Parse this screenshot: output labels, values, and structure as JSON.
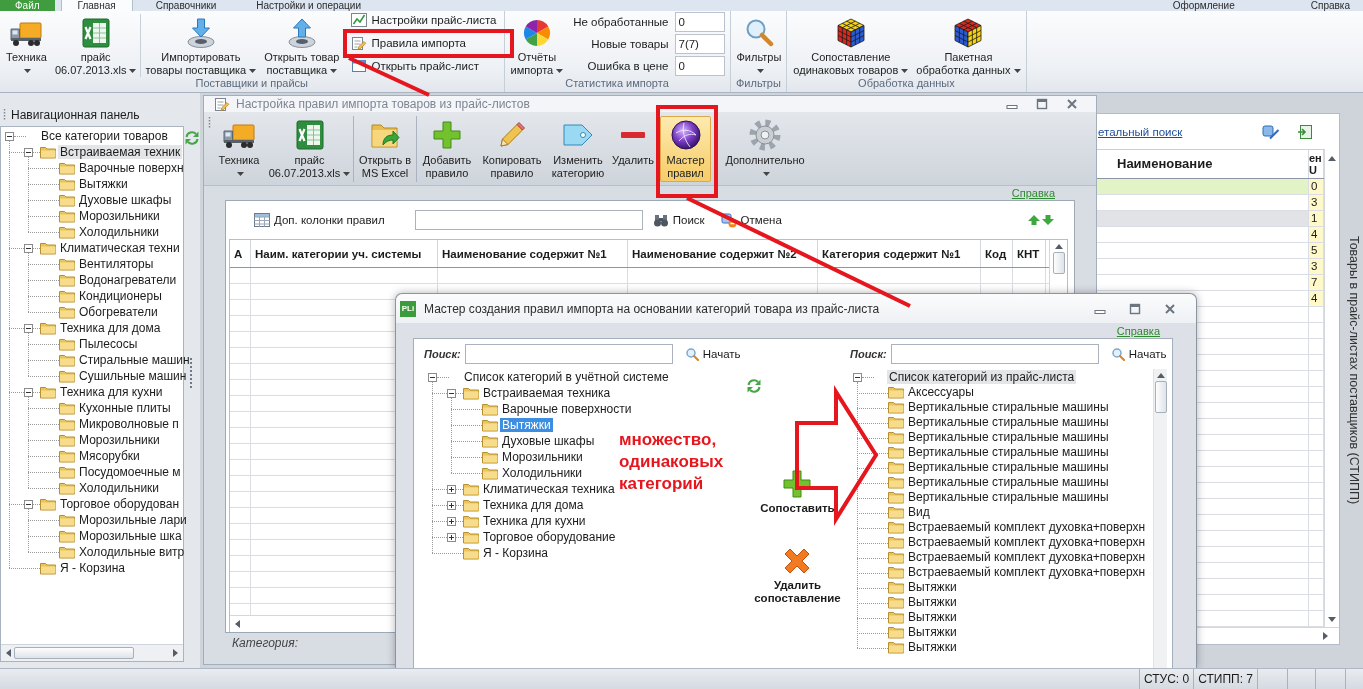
{
  "tabs": [
    {
      "label": "Файл",
      "kind": "file",
      "selected": false
    },
    {
      "label": "Главная",
      "kind": "tab",
      "selected": true
    },
    {
      "label": "Справочники",
      "kind": "tab",
      "selected": false
    },
    {
      "label": "Настройки и операции",
      "kind": "tab",
      "selected": false
    }
  ],
  "tabs_right": [
    "Оформление",
    "Справка"
  ],
  "ribbon": {
    "groups": [
      {
        "label": "Поставщики и прайсы",
        "sections": [
          [
            {
              "kind": "large",
              "label": [
                "Техника"
              ],
              "dropdown": true
            },
            {
              "kind": "large",
              "label": [
                "прайс",
                "06.07.2013.xls"
              ],
              "dropdown": true
            }
          ],
          [
            {
              "kind": "large",
              "label": [
                "Импортировать",
                "товары поставщика"
              ],
              "dropdown": true
            },
            {
              "kind": "large",
              "label": [
                "Открыть товар",
                "поставщика"
              ],
              "dropdown": true
            },
            {
              "kind": "small_stack",
              "items": [
                "Настройки прайс-листа",
                "Правила импорта",
                "Открыть прайс-лист"
              ]
            }
          ]
        ]
      },
      {
        "label": "Статистика импорта",
        "sections": [
          [
            {
              "kind": "large",
              "label": [
                "Отчёты",
                "импорта"
              ],
              "dropdown": true
            },
            {
              "kind": "stats",
              "rows": [
                {
                  "label": "Не обработанные",
                  "value": "0"
                },
                {
                  "label": "Новые товары",
                  "value": "7(7)"
                },
                {
                  "label": "Ошибка в цене",
                  "value": "0"
                }
              ]
            }
          ]
        ]
      },
      {
        "label": "Фильтры",
        "sections": [
          [
            {
              "kind": "large",
              "label": [
                "Фильтры"
              ],
              "dropdown": true
            }
          ]
        ]
      },
      {
        "label": "Обработка данных",
        "sections": [
          [
            {
              "kind": "large",
              "label": [
                "Сопоставление",
                "одинаковых товаров"
              ],
              "dropdown": true
            },
            {
              "kind": "large",
              "label": [
                "Пакетная",
                "обработка данных"
              ],
              "dropdown": true
            }
          ]
        ]
      }
    ]
  },
  "navigation": {
    "title": "Навигационная панель",
    "focused": false,
    "tree": {
      "label": "Все категории товаров",
      "expanded": true,
      "selected": false,
      "children": [
        {
          "label": "Встраиваемая техник",
          "expanded": true,
          "selected": true,
          "children": [
            {
              "label": "Варочные поверхн",
              "selected": false
            },
            {
              "label": "Вытяжки",
              "selected": false
            },
            {
              "label": "Духовые шкафы",
              "selected": false
            },
            {
              "label": "Морозильники",
              "selected": false
            },
            {
              "label": "Холодильники",
              "selected": false
            }
          ]
        },
        {
          "label": "Климатическая техни",
          "expanded": true,
          "selected": false,
          "children": [
            {
              "label": "Вентиляторы",
              "selected": false
            },
            {
              "label": "Водонагреватели",
              "selected": false
            },
            {
              "label": "Кондиционеры",
              "selected": false
            },
            {
              "label": "Обогреватели",
              "selected": false
            }
          ]
        },
        {
          "label": "Техника для дома",
          "expanded": true,
          "selected": false,
          "children": [
            {
              "label": "Пылесосы",
              "selected": false
            },
            {
              "label": "Стиральные машин",
              "selected": false
            },
            {
              "label": "Сушильные машин",
              "selected": false
            }
          ]
        },
        {
          "label": "Техника для кухни",
          "expanded": true,
          "selected": false,
          "children": [
            {
              "label": "Кухонные плиты",
              "selected": false
            },
            {
              "label": "Микроволновые п",
              "selected": false
            },
            {
              "label": "Морозильники",
              "selected": false
            },
            {
              "label": "Мясорубки",
              "selected": false
            },
            {
              "label": "Посудомоечные м",
              "selected": false
            },
            {
              "label": "Холодильники",
              "selected": false
            }
          ]
        },
        {
          "label": "Торговое оборудован",
          "expanded": true,
          "selected": false,
          "children": [
            {
              "label": "Морозильные лари",
              "selected": false
            },
            {
              "label": "Морозильные шка",
              "selected": false
            },
            {
              "label": "Холодильные витр",
              "selected": false
            }
          ]
        },
        {
          "label": "Я - Корзина",
          "selected": false
        }
      ]
    }
  },
  "rules_window": {
    "title": "Настройка правил импорта товаров из прайс-листов",
    "toolbar": [
      [
        {
          "label": [
            "Техника"
          ],
          "dropdown": true,
          "selected": false
        },
        {
          "label": [
            "прайс",
            "06.07.2013.xls"
          ],
          "dropdown": true,
          "selected": false
        }
      ],
      [
        {
          "label": [
            "Открыть в",
            "MS Excel"
          ],
          "dropdown": false,
          "selected": false
        }
      ],
      [
        {
          "label": [
            "Добавить",
            "правило"
          ],
          "dropdown": false,
          "selected": false
        },
        {
          "label": [
            "Копировать",
            "правило"
          ],
          "dropdown": false,
          "selected": false
        },
        {
          "label": [
            "Изменить",
            "категорию"
          ],
          "dropdown": false,
          "selected": false
        },
        {
          "label": [
            "Удалить"
          ],
          "dropdown": false,
          "selected": false
        },
        {
          "label": [
            "Мастер",
            "правил"
          ],
          "dropdown": false,
          "selected": true
        },
        {
          "label": [
            "Дополнительно"
          ],
          "dropdown": true,
          "selected": false
        }
      ]
    ],
    "help": "Справка",
    "extra_columns_button": "Доп. колонки правил",
    "search_button": "Поиск",
    "cancel_button": "Отмена",
    "table": {
      "columns": [
        "А",
        "Наим. категории уч. системы",
        "Наименование содержит №1",
        "Наименование содержит №2",
        "Категория содержит №1",
        "Код",
        "КНТ"
      ]
    },
    "footer_label": "Категория:"
  },
  "price_list": {
    "link": "етальный поиск",
    "columns": [
      "Наименование",
      "ен U"
    ],
    "rows": [
      {
        "column_2": "0",
        "highlighted": true,
        "selected": false
      },
      {
        "column_2": "3",
        "highlighted": false,
        "selected": false
      },
      {
        "column_2": "1",
        "highlighted": false,
        "selected": true
      },
      {
        "column_2": "4",
        "highlighted": false,
        "selected": false
      },
      {
        "column_2": "5",
        "highlighted": false,
        "selected": false
      },
      {
        "column_2": "3",
        "highlighted": false,
        "selected": false
      },
      {
        "column_2": "7",
        "highlighted": false,
        "selected": false
      },
      {
        "column_2": "4",
        "highlighted": false,
        "selected": false
      }
    ],
    "side_tab": "Товары в прайс-листах поставщиков (СТИПП)"
  },
  "wizard": {
    "app_icon": "PLi",
    "title": "Мастер создания правил импорта на основании категорий товара из прайс-листа",
    "help": "Справка",
    "left": {
      "search_label": "Поиск:",
      "search_button": "Начать",
      "focused": true,
      "tree": {
        "label": "Список категорий в учётной системе",
        "expanded": true,
        "selected": false,
        "children": [
          {
            "label": "Встраиваемая техника",
            "expanded": true,
            "selected": false,
            "children": [
              {
                "label": "Варочные поверхности",
                "selected": false
              },
              {
                "label": "Вытяжки",
                "selected": true
              },
              {
                "label": "Духовые шкафы",
                "selected": false
              },
              {
                "label": "Морозильники",
                "selected": false
              },
              {
                "label": "Холодильники",
                "selected": false
              }
            ]
          },
          {
            "label": "Климатическая техника",
            "expanded": false,
            "selected": false
          },
          {
            "label": "Техника для дома",
            "expanded": false,
            "selected": false
          },
          {
            "label": "Техника для кухни",
            "expanded": false,
            "selected": false
          },
          {
            "label": "Торговое оборудование",
            "expanded": false,
            "selected": false
          },
          {
            "label": "Я - Корзина",
            "selected": false
          }
        ]
      }
    },
    "actions": [
      {
        "kind": "match",
        "label": [
          "Сопоставить"
        ]
      },
      {
        "kind": "unmatch",
        "label": [
          "Удалить",
          "сопоставление"
        ]
      }
    ],
    "right": {
      "search_label": "Поиск:",
      "search_button": "Начать",
      "focused": false,
      "tree": {
        "label": "Список категорий из прайс-листа",
        "expanded": true,
        "selected": true,
        "children": [
          {
            "label": "Аксессуары",
            "selected": false
          },
          {
            "label": "Вертикальные стиральные машины",
            "selected": false
          },
          {
            "label": "Вертикальные стиральные машины",
            "selected": false
          },
          {
            "label": "Вертикальные стиральные машины",
            "selected": false
          },
          {
            "label": "Вертикальные стиральные машины",
            "selected": false
          },
          {
            "label": "Вертикальные стиральные машины",
            "selected": false
          },
          {
            "label": "Вертикальные стиральные машины",
            "selected": false
          },
          {
            "label": "Вертикальные стиральные машины",
            "selected": false
          },
          {
            "label": "Вид",
            "selected": false
          },
          {
            "label": "Встраеваемый комплект духовка+поверхн",
            "selected": false
          },
          {
            "label": "Встраеваемый комплект духовка+поверхн",
            "selected": false
          },
          {
            "label": "Встраеваемый комплект духовка+поверхн",
            "selected": false
          },
          {
            "label": "Встраеваемый комплект духовка+поверхн",
            "selected": false
          },
          {
            "label": "Вытяжки",
            "selected": false
          },
          {
            "label": "Вытяжки",
            "selected": false
          },
          {
            "label": "Вытяжки",
            "selected": false
          },
          {
            "label": "Вытяжки",
            "selected": false
          },
          {
            "label": "Вытяжки",
            "selected": false
          }
        ]
      }
    }
  },
  "annotation": {
    "note": "множество, одинаковых категорий"
  },
  "status_bar": [
    "СТУС: 0",
    "СТИПП: 7"
  ]
}
